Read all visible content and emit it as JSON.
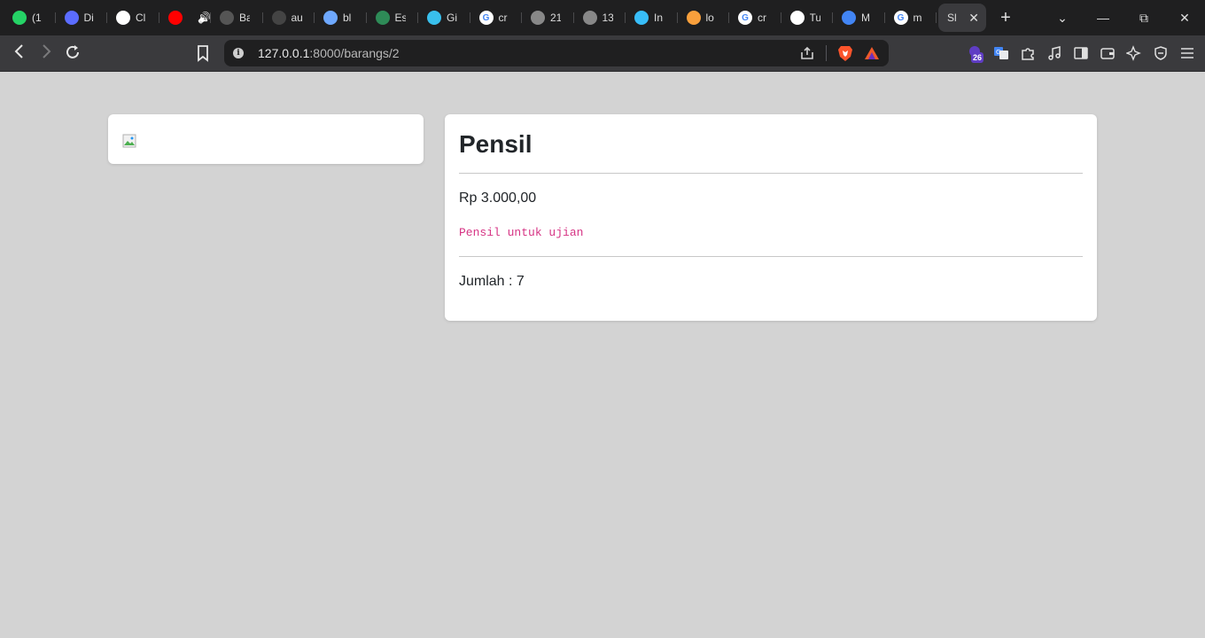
{
  "browser": {
    "tabs": [
      {
        "label": "(1",
        "icon": "whatsapp-icon",
        "color": "#25d366"
      },
      {
        "label": "Di",
        "icon": "devin-icon",
        "color": "#5b6cff"
      },
      {
        "label": "Cl",
        "icon": "openai-icon",
        "color": "#ffffff"
      },
      {
        "label": "",
        "icon": "youtube-icon",
        "color": "#ff0000"
      },
      {
        "label": "Ba",
        "icon": "keyboard-icon",
        "color": "#555555"
      },
      {
        "label": "au",
        "icon": "loading-icon",
        "color": "#444444"
      },
      {
        "label": "bl",
        "icon": "gem-icon",
        "color": "#6ea8fe"
      },
      {
        "label": "Es",
        "icon": "globe-icon",
        "color": "#2e8b57"
      },
      {
        "label": "Gi",
        "icon": "orb-icon",
        "color": "#39c0ed"
      },
      {
        "label": "cr",
        "icon": "google-icon",
        "color": "#ffffff"
      },
      {
        "label": "21",
        "icon": "github-icon",
        "color": "#888888"
      },
      {
        "label": "13",
        "icon": "github-icon",
        "color": "#888888"
      },
      {
        "label": "In",
        "icon": "tailwind-icon",
        "color": "#38bdf8"
      },
      {
        "label": "lo",
        "icon": "laravel-icon",
        "color": "#f9a03c"
      },
      {
        "label": "cr",
        "icon": "google-icon",
        "color": "#ffffff"
      },
      {
        "label": "Tu",
        "icon": "chat-icon",
        "color": "#ffffff"
      },
      {
        "label": "M",
        "icon": "meet-icon",
        "color": "#4285f4"
      },
      {
        "label": "m",
        "icon": "google-icon",
        "color": "#ffffff"
      }
    ],
    "active_tab": {
      "label": "Sl"
    },
    "url_host": "127.0.0.1",
    "url_path": ":8000/barangs/2",
    "extension_badge": "26"
  },
  "product": {
    "name": "Pensil",
    "price": "Rp 3.000,00",
    "description": "Pensil untuk ujian",
    "quantity": "Jumlah : 7"
  },
  "colors": {
    "page_bg": "#d3d3d3",
    "accent_code": "#d63384",
    "tabstrip_bg": "#1f1f20",
    "toolbar_bg": "#3a3a3d"
  }
}
